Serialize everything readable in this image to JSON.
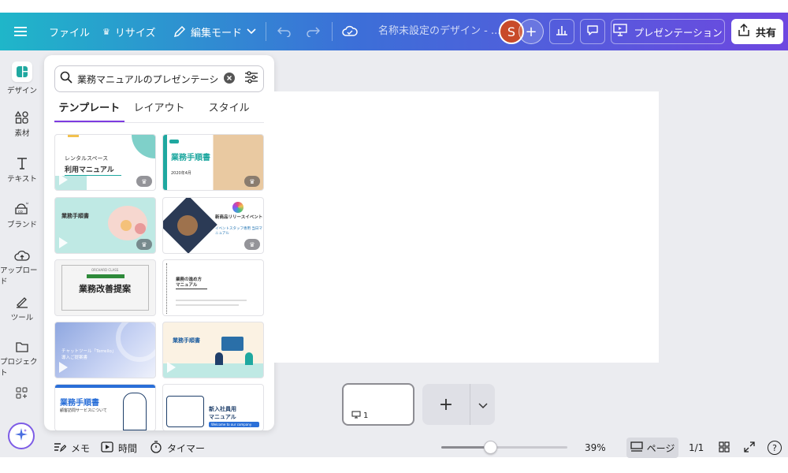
{
  "topbar": {
    "file_label": "ファイル",
    "resize_label": "リサイズ",
    "edit_mode_label": "編集モード",
    "doc_title": "名称未設定のデザイン - ...",
    "avatar_initial": "S",
    "present_label": "プレゼンテーション",
    "share_label": "共有"
  },
  "rail": {
    "items": [
      {
        "label": "デザイン",
        "icon": "design-icon"
      },
      {
        "label": "素材",
        "icon": "elements-icon"
      },
      {
        "label": "テキスト",
        "icon": "text-icon"
      },
      {
        "label": "ブランド",
        "icon": "brand-icon"
      },
      {
        "label": "アップロード",
        "icon": "upload-icon"
      },
      {
        "label": "ツール",
        "icon": "tools-icon"
      },
      {
        "label": "プロジェクト",
        "icon": "folder-icon"
      }
    ]
  },
  "panel": {
    "search_value": "業務マニュアルのプレゼンテーション",
    "tabs": [
      "テンプレート",
      "レイアウト",
      "スタイル"
    ],
    "cards": [
      {
        "line1": "レンタルスペース",
        "line2": "利用マニュアル"
      },
      {
        "line1": "業務手順書",
        "line2": "2020年4月"
      },
      {
        "line1": "業務手順書",
        "line2": ""
      },
      {
        "line1": "新商品リリースイベント",
        "line2": "イベントスタッフ専用 当日マニュアル"
      },
      {
        "line1": "業務改善提案",
        "line2": "ORCHARD CLASS"
      },
      {
        "line1": "業務の進め方",
        "line2": "マニュアル"
      },
      {
        "line1": "チャットツール「Terrello」",
        "line2": "導入ご提案書"
      },
      {
        "line1": "業務手順書",
        "line2": ""
      },
      {
        "line1": "業務手順書",
        "line2": "顧客訪問サービスについて"
      },
      {
        "line1": "新入社員用",
        "line2": "マニュアル"
      }
    ],
    "card_card9_badge": "Welcome to our company"
  },
  "pages": {
    "thumb_number": "1"
  },
  "footer": {
    "memo_label": "メモ",
    "time_label": "時間",
    "timer_label": "タイマー",
    "zoom_percent": "39%",
    "zoom_value": 0.39,
    "page_label": "ページ",
    "page_count": "1/1",
    "help_label": "?"
  },
  "colors": {
    "accent": "#7d3be0",
    "teal": "#1fa8a0"
  }
}
